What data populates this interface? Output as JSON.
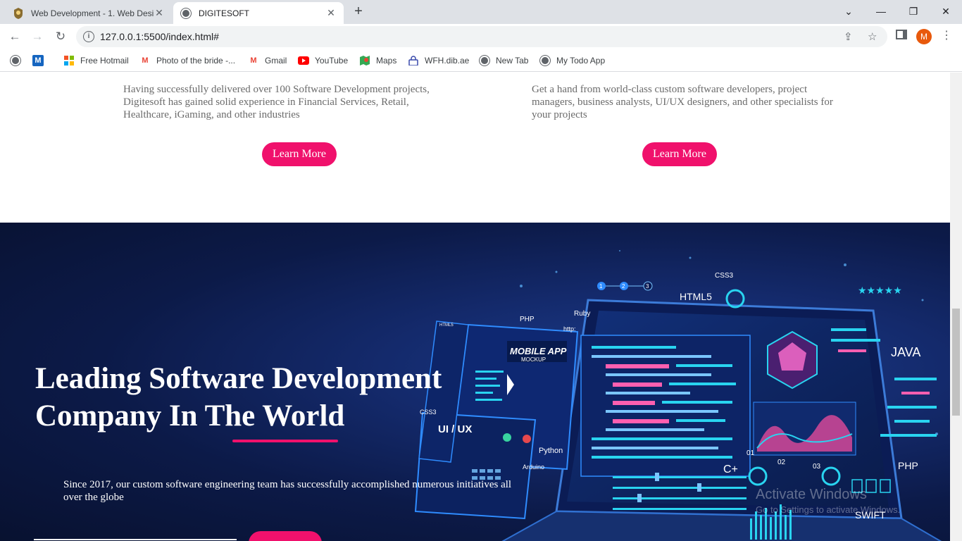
{
  "browser": {
    "tabs": [
      {
        "title": "Web Development - 1. Web Desi",
        "active": false
      },
      {
        "title": "DIGITESOFT",
        "active": true
      }
    ],
    "url": "127.0.0.1:5500/index.html#",
    "profile_initial": "M",
    "bookmarks": [
      {
        "label": "",
        "icon": "globe-icon"
      },
      {
        "label": "",
        "icon": "m-app-icon"
      },
      {
        "label": "Free Hotmail",
        "icon": "windows-icon"
      },
      {
        "label": "Photo of the bride -...",
        "icon": "gmail-icon"
      },
      {
        "label": "Gmail",
        "icon": "gmail-icon"
      },
      {
        "label": "YouTube",
        "icon": "youtube-icon"
      },
      {
        "label": "Maps",
        "icon": "maps-icon"
      },
      {
        "label": "WFH.dib.ae",
        "icon": "lock-site-icon"
      },
      {
        "label": "New Tab",
        "icon": "globe-icon"
      },
      {
        "label": "My Todo App",
        "icon": "globe-icon"
      }
    ]
  },
  "services": {
    "left_text": "Having successfully delivered over 100 Software Development projects, Digitesoft has gained solid experience in Financial Services, Retail, Healthcare, iGaming, and other industries",
    "right_text": "Get a hand from world-class custom software developers, project managers, business analysts, UI/UX designers, and other specialists for your projects",
    "left_button": "Learn More",
    "right_button": "Learn More"
  },
  "hero": {
    "title_line1": "Leading Software Development",
    "title_line2": "Company In The World",
    "description": "Since 2017, our custom software engineering team has successfully accomplished numerous initiatives all over the globe",
    "illustration_labels": {
      "css": "CSS3",
      "html": "HTML5",
      "php": "PHP",
      "ruby": "Ruby",
      "http": "http:",
      "mobile": "MOBILE APP",
      "mockup": "MOCKUP",
      "uiux": "UI / UX",
      "python": "Python",
      "arduino": "Arduino",
      "java": "JAVA",
      "swift": "SWIFT",
      "cplus": "C+",
      "php2": "PHP",
      "css2": "CSS3",
      "html_small": "HTML5",
      "step1": "1",
      "step2": "2",
      "step3": "3",
      "num01": "01",
      "num02": "02",
      "num03": "03",
      "stars": "★★★★★"
    }
  },
  "watermark": {
    "line1": "Activate Windows",
    "line2": "Go to Settings to activate Windows."
  },
  "colors": {
    "accent": "#f0116c",
    "hero_dark": "#0c1a48",
    "neon": "#29d4f0"
  }
}
